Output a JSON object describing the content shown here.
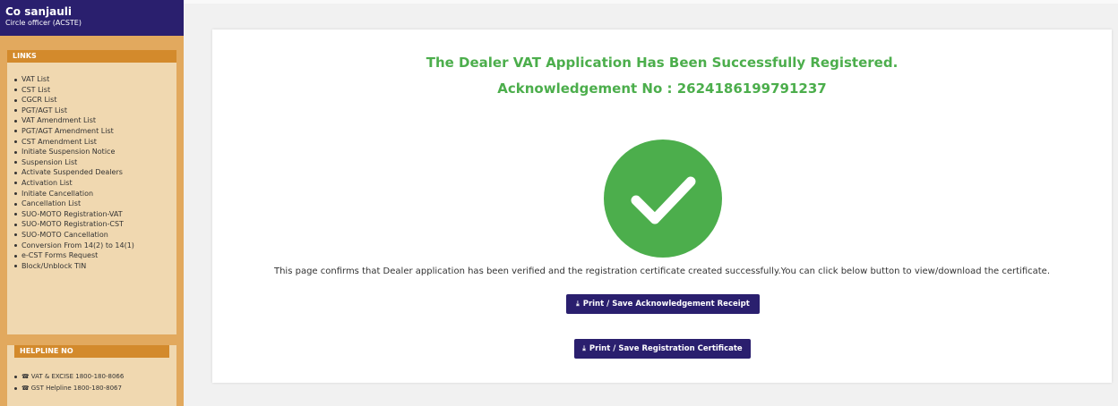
{
  "user": {
    "name": "Co sanjauli",
    "role": "Circle officer (ACSTE)"
  },
  "sidebar": {
    "links_header": "LINKS",
    "links": [
      "VAT List",
      "CST List",
      "CGCR List",
      "PGT/AGT List",
      "VAT Amendment List",
      "PGT/AGT Amendment List",
      "CST Amendment List",
      "Initiate Suspension Notice",
      "Suspension List",
      "Activate Suspended Dealers",
      "Activation List",
      "Initiate Cancellation",
      "Cancellation List",
      "SUO-MOTO Registration-VAT",
      "SUO-MOTO Registration-CST",
      "SUO-MOTO Cancellation",
      "Conversion From 14(2) to 14(1)",
      "e-CST Forms Request",
      "Block/Unblock TIN"
    ],
    "helpline_header": "HELPLINE NO",
    "helplines": [
      "VAT & EXCISE 1800-180-8066",
      "GST Helpline 1800-180-8067"
    ],
    "phone_icon": "☎"
  },
  "main": {
    "title": "The Dealer VAT Application Has Been Successfully Registered.",
    "ack": "Acknowledgement No : 2624186199791237",
    "confirm_text": "This page confirms that Dealer application has been verified and the registration certificate created successfully.You can click below button to view/download the certificate.",
    "btn_ack": "Print / Save Acknowledgement Receipt",
    "btn_cert": "Print / Save Registration Certificate",
    "download_icon": "⤓"
  },
  "colors": {
    "sidebar_bg": "#e2a95e",
    "header_bg": "#2a1f6e",
    "success_green": "#4cae4c",
    "button_bg": "#2a1f6e"
  }
}
